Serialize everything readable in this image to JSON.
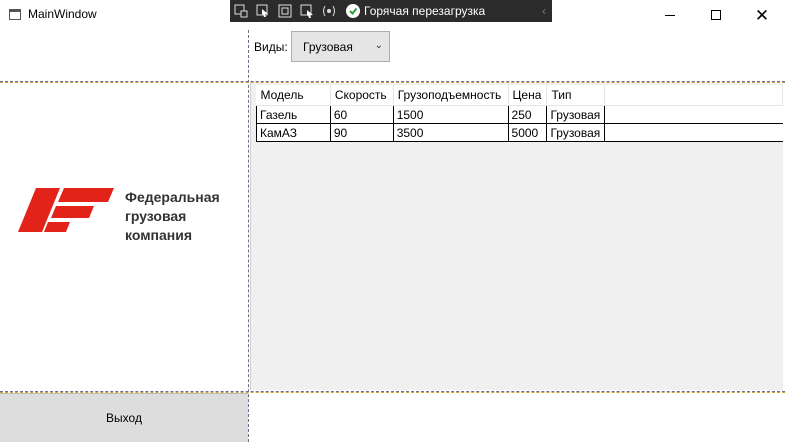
{
  "window": {
    "title": "MainWindow"
  },
  "devbar": {
    "hot_reload_label": "Горячая перезагрузка"
  },
  "filter": {
    "label": "Виды:",
    "selected": "Грузовая"
  },
  "logo": {
    "line1": "Федеральная",
    "line2": "грузовая",
    "line3": "компания",
    "color": "#e2231a"
  },
  "table": {
    "columns": [
      "Модель",
      "Скорость",
      "Грузоподъемность",
      "Цена",
      "Тип"
    ],
    "rows": [
      [
        "Газель",
        "60",
        "1500",
        "250",
        "Грузовая"
      ],
      [
        "КамАЗ",
        "90",
        "3500",
        "5000",
        "Грузовая"
      ]
    ]
  },
  "exit_button": {
    "label": "Выход"
  }
}
